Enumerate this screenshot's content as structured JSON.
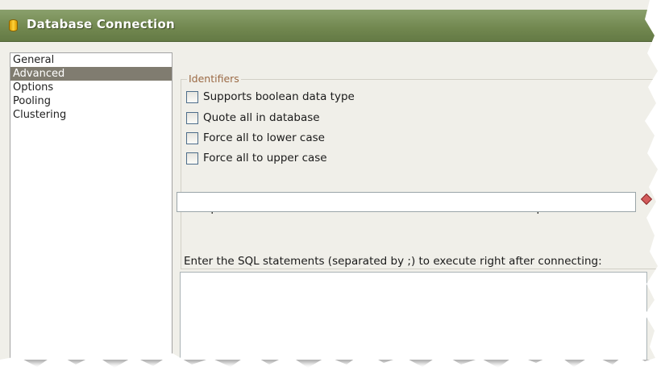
{
  "window": {
    "title": "Database Connection",
    "icon": "database-icon",
    "accent_color": "#71874f"
  },
  "nav": {
    "items": [
      {
        "label": "General",
        "selected": false
      },
      {
        "label": "Advanced",
        "selected": true
      },
      {
        "label": "Options",
        "selected": false
      },
      {
        "label": "Pooling",
        "selected": false
      },
      {
        "label": "Clustering",
        "selected": false
      }
    ]
  },
  "identifiers": {
    "legend": "Identifiers",
    "options": [
      {
        "label": "Supports boolean data type",
        "checked": false
      },
      {
        "label": "Quote all in database",
        "checked": false
      },
      {
        "label": "Force all to lower case",
        "checked": false
      },
      {
        "label": "Force all to upper case",
        "checked": false
      }
    ],
    "schema_hint": "The preferred schema name. Is used when no other schema is specified.",
    "schema_value": ""
  },
  "sql": {
    "label": "Enter the SQL statements (separated by ;) to execute right after connecting:",
    "value": ""
  }
}
